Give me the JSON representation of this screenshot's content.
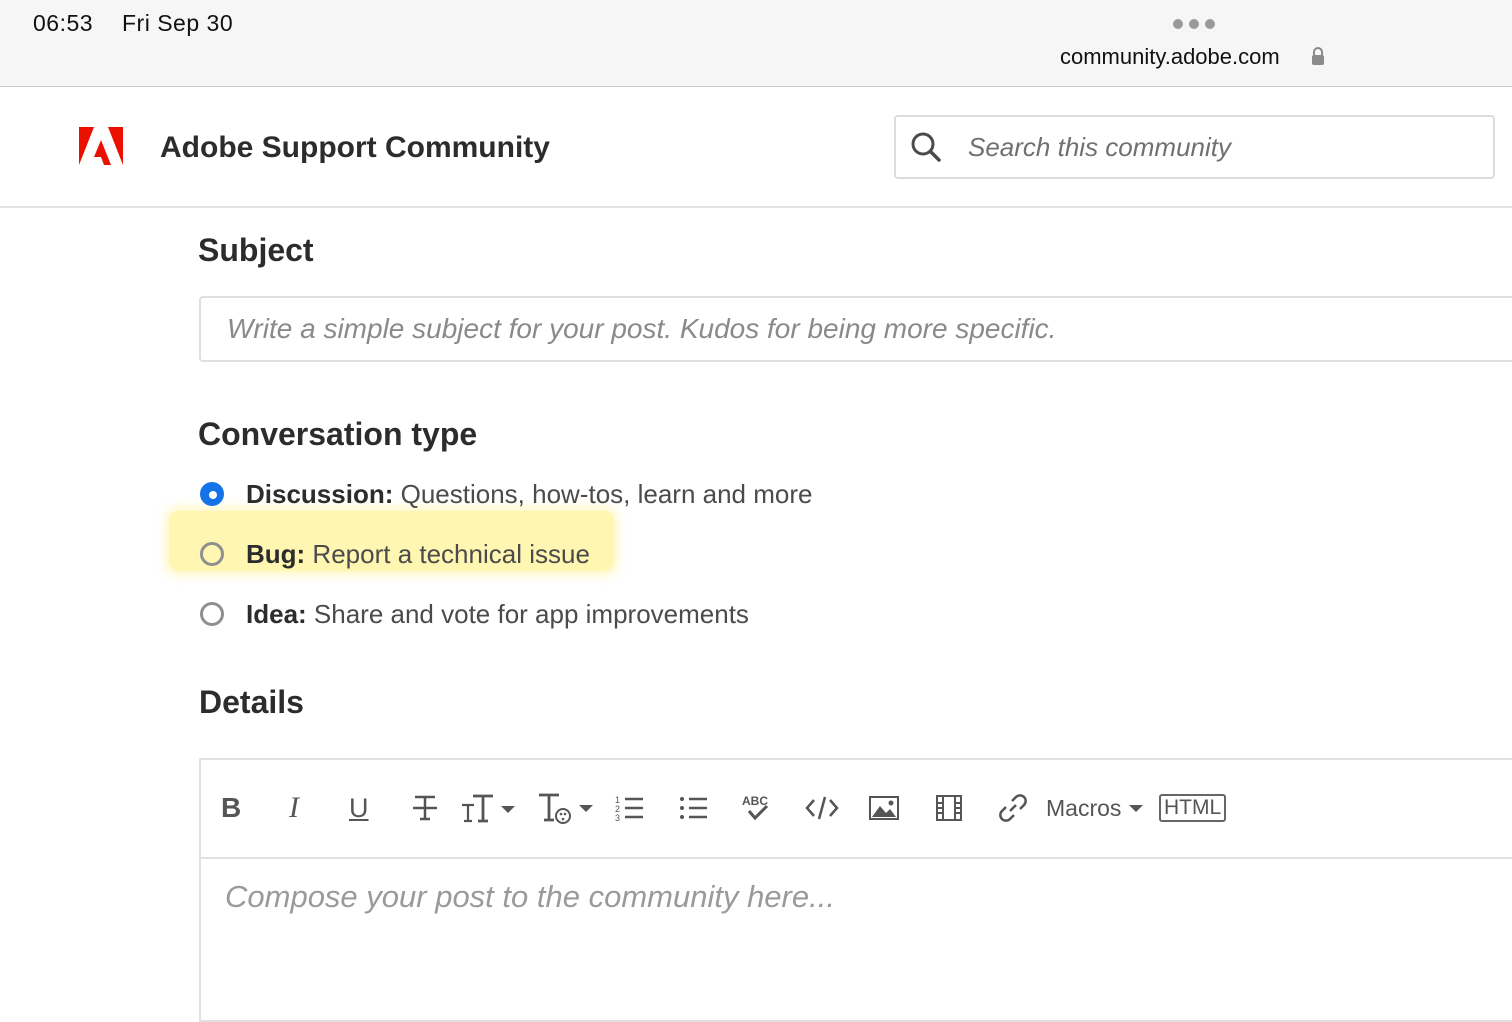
{
  "status_bar": {
    "time": "06:53",
    "date": "Fri Sep 30",
    "url": "community.adobe.com"
  },
  "header": {
    "title": "Adobe Support Community",
    "search_placeholder": "Search this community",
    "brand_color": "#eb1000"
  },
  "subject": {
    "heading": "Subject",
    "placeholder": "Write a simple subject for your post. Kudos for being more specific."
  },
  "conversation_type": {
    "heading": "Conversation type",
    "options": [
      {
        "label": "Discussion:",
        "description": " Questions, how-tos, learn and more",
        "selected": true
      },
      {
        "label": "Bug:",
        "description": " Report a technical issue",
        "selected": false,
        "highlighted": true
      },
      {
        "label": "Idea:",
        "description": " Share and vote for app improvements",
        "selected": false
      }
    ]
  },
  "details": {
    "heading": "Details",
    "toolbar": {
      "bold": "B",
      "italic": "I",
      "underline": "U",
      "macros_label": "Macros",
      "html_label": "HTML"
    },
    "compose_placeholder": "Compose your post to the community here..."
  }
}
